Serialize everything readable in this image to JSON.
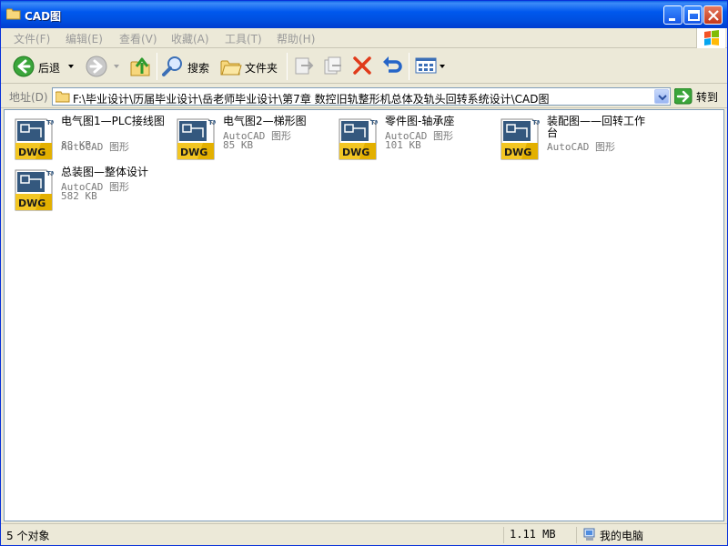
{
  "window": {
    "title": "CAD图"
  },
  "menu": [
    "文件(F)",
    "编辑(E)",
    "查看(V)",
    "收藏(A)",
    "工具(T)",
    "帮助(H)"
  ],
  "toolbar": {
    "back_label": "后退",
    "search_label": "搜索",
    "folders_label": "文件夹"
  },
  "address": {
    "label": "地址(D)",
    "path": "F:\\毕业设计\\历届毕业设计\\岳老师毕业设计\\第7章 数控旧轨整形机总体及轨头回转系统设计\\CAD图",
    "go_label": "转到"
  },
  "files": [
    {
      "name": "电气图1—PLC接线图",
      "type": "AutoCAD 图形",
      "size": "88 KB"
    },
    {
      "name": "电气图2—梯形图",
      "type": "AutoCAD 图形",
      "size": "85 KB"
    },
    {
      "name": "零件图-轴承座",
      "type": "AutoCAD 图形",
      "size": "101 KB"
    },
    {
      "name": "装配图——回转工作台",
      "type": "AutoCAD 图形",
      "size": ""
    },
    {
      "name": "总装图—整体设计",
      "type": "AutoCAD 图形",
      "size": "582 KB"
    }
  ],
  "icon_label": "DWG",
  "status": {
    "count": "5 个对象",
    "size": "1.11 MB",
    "location": "我的电脑"
  },
  "colors": {
    "titlebar": "#0058ee",
    "dwg_yellow": "#f3c623",
    "dwg_blue": "#34587e"
  }
}
